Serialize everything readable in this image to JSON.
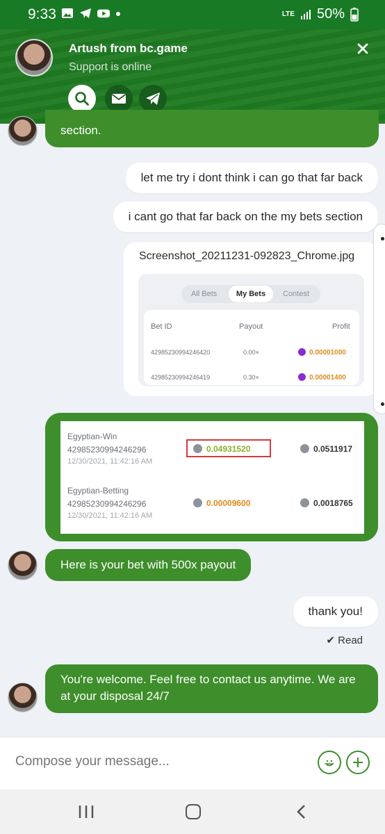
{
  "status_bar": {
    "time": "9:33",
    "network": "LTE",
    "battery": "50%"
  },
  "header": {
    "agent_name": "Artush from bc.game",
    "agent_status": "Support is online",
    "actions": [
      "search-icon",
      "mail-icon",
      "telegram-icon"
    ]
  },
  "messages": {
    "partial": "section.",
    "user1": "let me try i dont think i can go that far back",
    "user2": "i cant go that far back on the my bets section",
    "attachment": {
      "filename": "Screenshot_20211231-092823_Chrome.jpg",
      "tabs": [
        "All Bets",
        "My Bets",
        "Contest"
      ],
      "columns": [
        "Bet ID",
        "Payout",
        "Profit"
      ],
      "rows": [
        {
          "bet_id": "42985230994246420",
          "payout": "0.00×",
          "profit": "0.00001000"
        },
        {
          "bet_id": "42985230994246419",
          "payout": "0.30×",
          "profit": "0.00001400"
        }
      ]
    },
    "bets_image": {
      "rows": [
        {
          "game": "Egyptian-Win",
          "bet_id": "42985230994246296",
          "time": "12/30/2021, 11:42:16 AM",
          "amount": "0.04931520",
          "amount2": "0.0511917"
        },
        {
          "game": "Egyptian-Betting",
          "bet_id": "42985230994246296",
          "time": "12/30/2021, 11:42:16 AM",
          "amount": "0.00009600",
          "amount2": "0.0018765"
        }
      ]
    },
    "agent1": "Here is your bet with 500x payout",
    "user3": "thank you!",
    "read_status": "Read",
    "agent2": "You're welcome. Feel free to contact us anytime. We are at your disposal 24/7"
  },
  "compose": {
    "placeholder": "Compose your message..."
  },
  "colors": {
    "brand_green": "#3e8e2b",
    "header_green": "#1f7a22",
    "highlight_red": "#d23a3a"
  }
}
